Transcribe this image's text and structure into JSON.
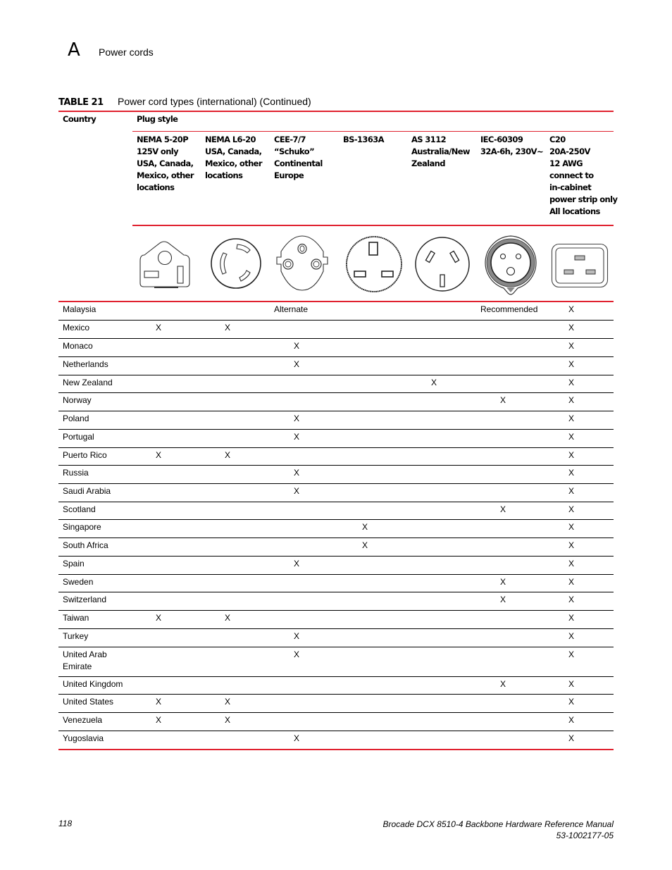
{
  "page_header": {
    "chapter_letter": "A",
    "section_title": "Power cords"
  },
  "table": {
    "number": "TABLE 21",
    "caption": "Power cord types (international) (Continued)",
    "country_header": "Country",
    "plug_style_header": "Plug style",
    "columns": [
      {
        "id": "nema-5-20p",
        "lines": [
          "NEMA 5-20P",
          "125V only",
          "USA, Canada,",
          "Mexico, other",
          "locations"
        ],
        "icon": "nema-5-20p-plug-icon"
      },
      {
        "id": "nema-l6-20",
        "lines": [
          "NEMA L6-20",
          "USA, Canada,",
          "Mexico, other",
          "locations"
        ],
        "icon": "nema-l6-20-plug-icon"
      },
      {
        "id": "cee-7-7",
        "lines": [
          "CEE-7/7",
          "“Schuko”",
          "Continental",
          "Europe"
        ],
        "icon": "schuko-plug-icon"
      },
      {
        "id": "bs-1363a",
        "lines": [
          "BS-1363A"
        ],
        "icon": "bs-1363a-plug-icon"
      },
      {
        "id": "as-3112",
        "lines": [
          "AS 3112",
          "Australia/New",
          "Zealand"
        ],
        "icon": "as-3112-plug-icon"
      },
      {
        "id": "iec-60309",
        "lines": [
          "IEC-60309",
          "32A-6h, 230V~"
        ],
        "icon": "iec-60309-plug-icon"
      },
      {
        "id": "c20",
        "lines": [
          "C20",
          "20A-250V",
          "12 AWG",
          "connect to",
          "in-cabinet",
          "power strip only",
          "All locations"
        ],
        "icon": "c20-plug-icon"
      }
    ],
    "rows": [
      {
        "country": "Malaysia",
        "cells": [
          "",
          "",
          "Alternate",
          "",
          "",
          "Recommended",
          "X"
        ]
      },
      {
        "country": "Mexico",
        "cells": [
          "X",
          "X",
          "",
          "",
          "",
          "",
          "X"
        ]
      },
      {
        "country": "Monaco",
        "cells": [
          "",
          "",
          "X",
          "",
          "",
          "",
          "X"
        ]
      },
      {
        "country": "Netherlands",
        "cells": [
          "",
          "",
          "X",
          "",
          "",
          "",
          "X"
        ]
      },
      {
        "country": "New Zealand",
        "cells": [
          "",
          "",
          "",
          "",
          "X",
          "",
          "X"
        ]
      },
      {
        "country": "Norway",
        "cells": [
          "",
          "",
          "",
          "",
          "",
          "X",
          "X"
        ]
      },
      {
        "country": "Poland",
        "cells": [
          "",
          "",
          "X",
          "",
          "",
          "",
          "X"
        ]
      },
      {
        "country": "Portugal",
        "cells": [
          "",
          "",
          "X",
          "",
          "",
          "",
          "X"
        ]
      },
      {
        "country": "Puerto Rico",
        "cells": [
          "X",
          "X",
          "",
          "",
          "",
          "",
          "X"
        ]
      },
      {
        "country": "Russia",
        "cells": [
          "",
          "",
          "X",
          "",
          "",
          "",
          "X"
        ]
      },
      {
        "country": "Saudi Arabia",
        "cells": [
          "",
          "",
          "X",
          "",
          "",
          "",
          "X"
        ]
      },
      {
        "country": "Scotland",
        "cells": [
          "",
          "",
          "",
          "",
          "",
          "X",
          "X"
        ]
      },
      {
        "country": "Singapore",
        "cells": [
          "",
          "",
          "",
          "X",
          "",
          "",
          "X"
        ]
      },
      {
        "country": "South Africa",
        "cells": [
          "",
          "",
          "",
          "X",
          "",
          "",
          "X"
        ]
      },
      {
        "country": "Spain",
        "cells": [
          "",
          "",
          "X",
          "",
          "",
          "",
          "X"
        ]
      },
      {
        "country": "Sweden",
        "cells": [
          "",
          "",
          "",
          "",
          "",
          "X",
          "X"
        ]
      },
      {
        "country": "Switzerland",
        "cells": [
          "",
          "",
          "",
          "",
          "",
          "X",
          "X"
        ]
      },
      {
        "country": "Taiwan",
        "cells": [
          "X",
          "X",
          "",
          "",
          "",
          "",
          "X"
        ]
      },
      {
        "country": "Turkey",
        "cells": [
          "",
          "",
          "X",
          "",
          "",
          "",
          "X"
        ]
      },
      {
        "country": "United Arab Emirate",
        "country_lines": [
          "United Arab",
          "Emirate"
        ],
        "cells": [
          "",
          "",
          "X",
          "",
          "",
          "",
          "X"
        ]
      },
      {
        "country": "United Kingdom",
        "cells": [
          "",
          "",
          "",
          "",
          "",
          "X",
          "X"
        ]
      },
      {
        "country": "United States",
        "cells": [
          "X",
          "X",
          "",
          "",
          "",
          "",
          "X"
        ]
      },
      {
        "country": "Venezuela",
        "cells": [
          "X",
          "X",
          "",
          "",
          "",
          "",
          "X"
        ]
      },
      {
        "country": "Yugoslavia",
        "cells": [
          "",
          "",
          "X",
          "",
          "",
          "",
          "X"
        ]
      }
    ]
  },
  "footer": {
    "page_number": "118",
    "manual_title": "Brocade DCX 8510-4 Backbone Hardware Reference Manual",
    "doc_number": "53-1002177-05"
  },
  "colors": {
    "rule_red": "#e0202e"
  }
}
